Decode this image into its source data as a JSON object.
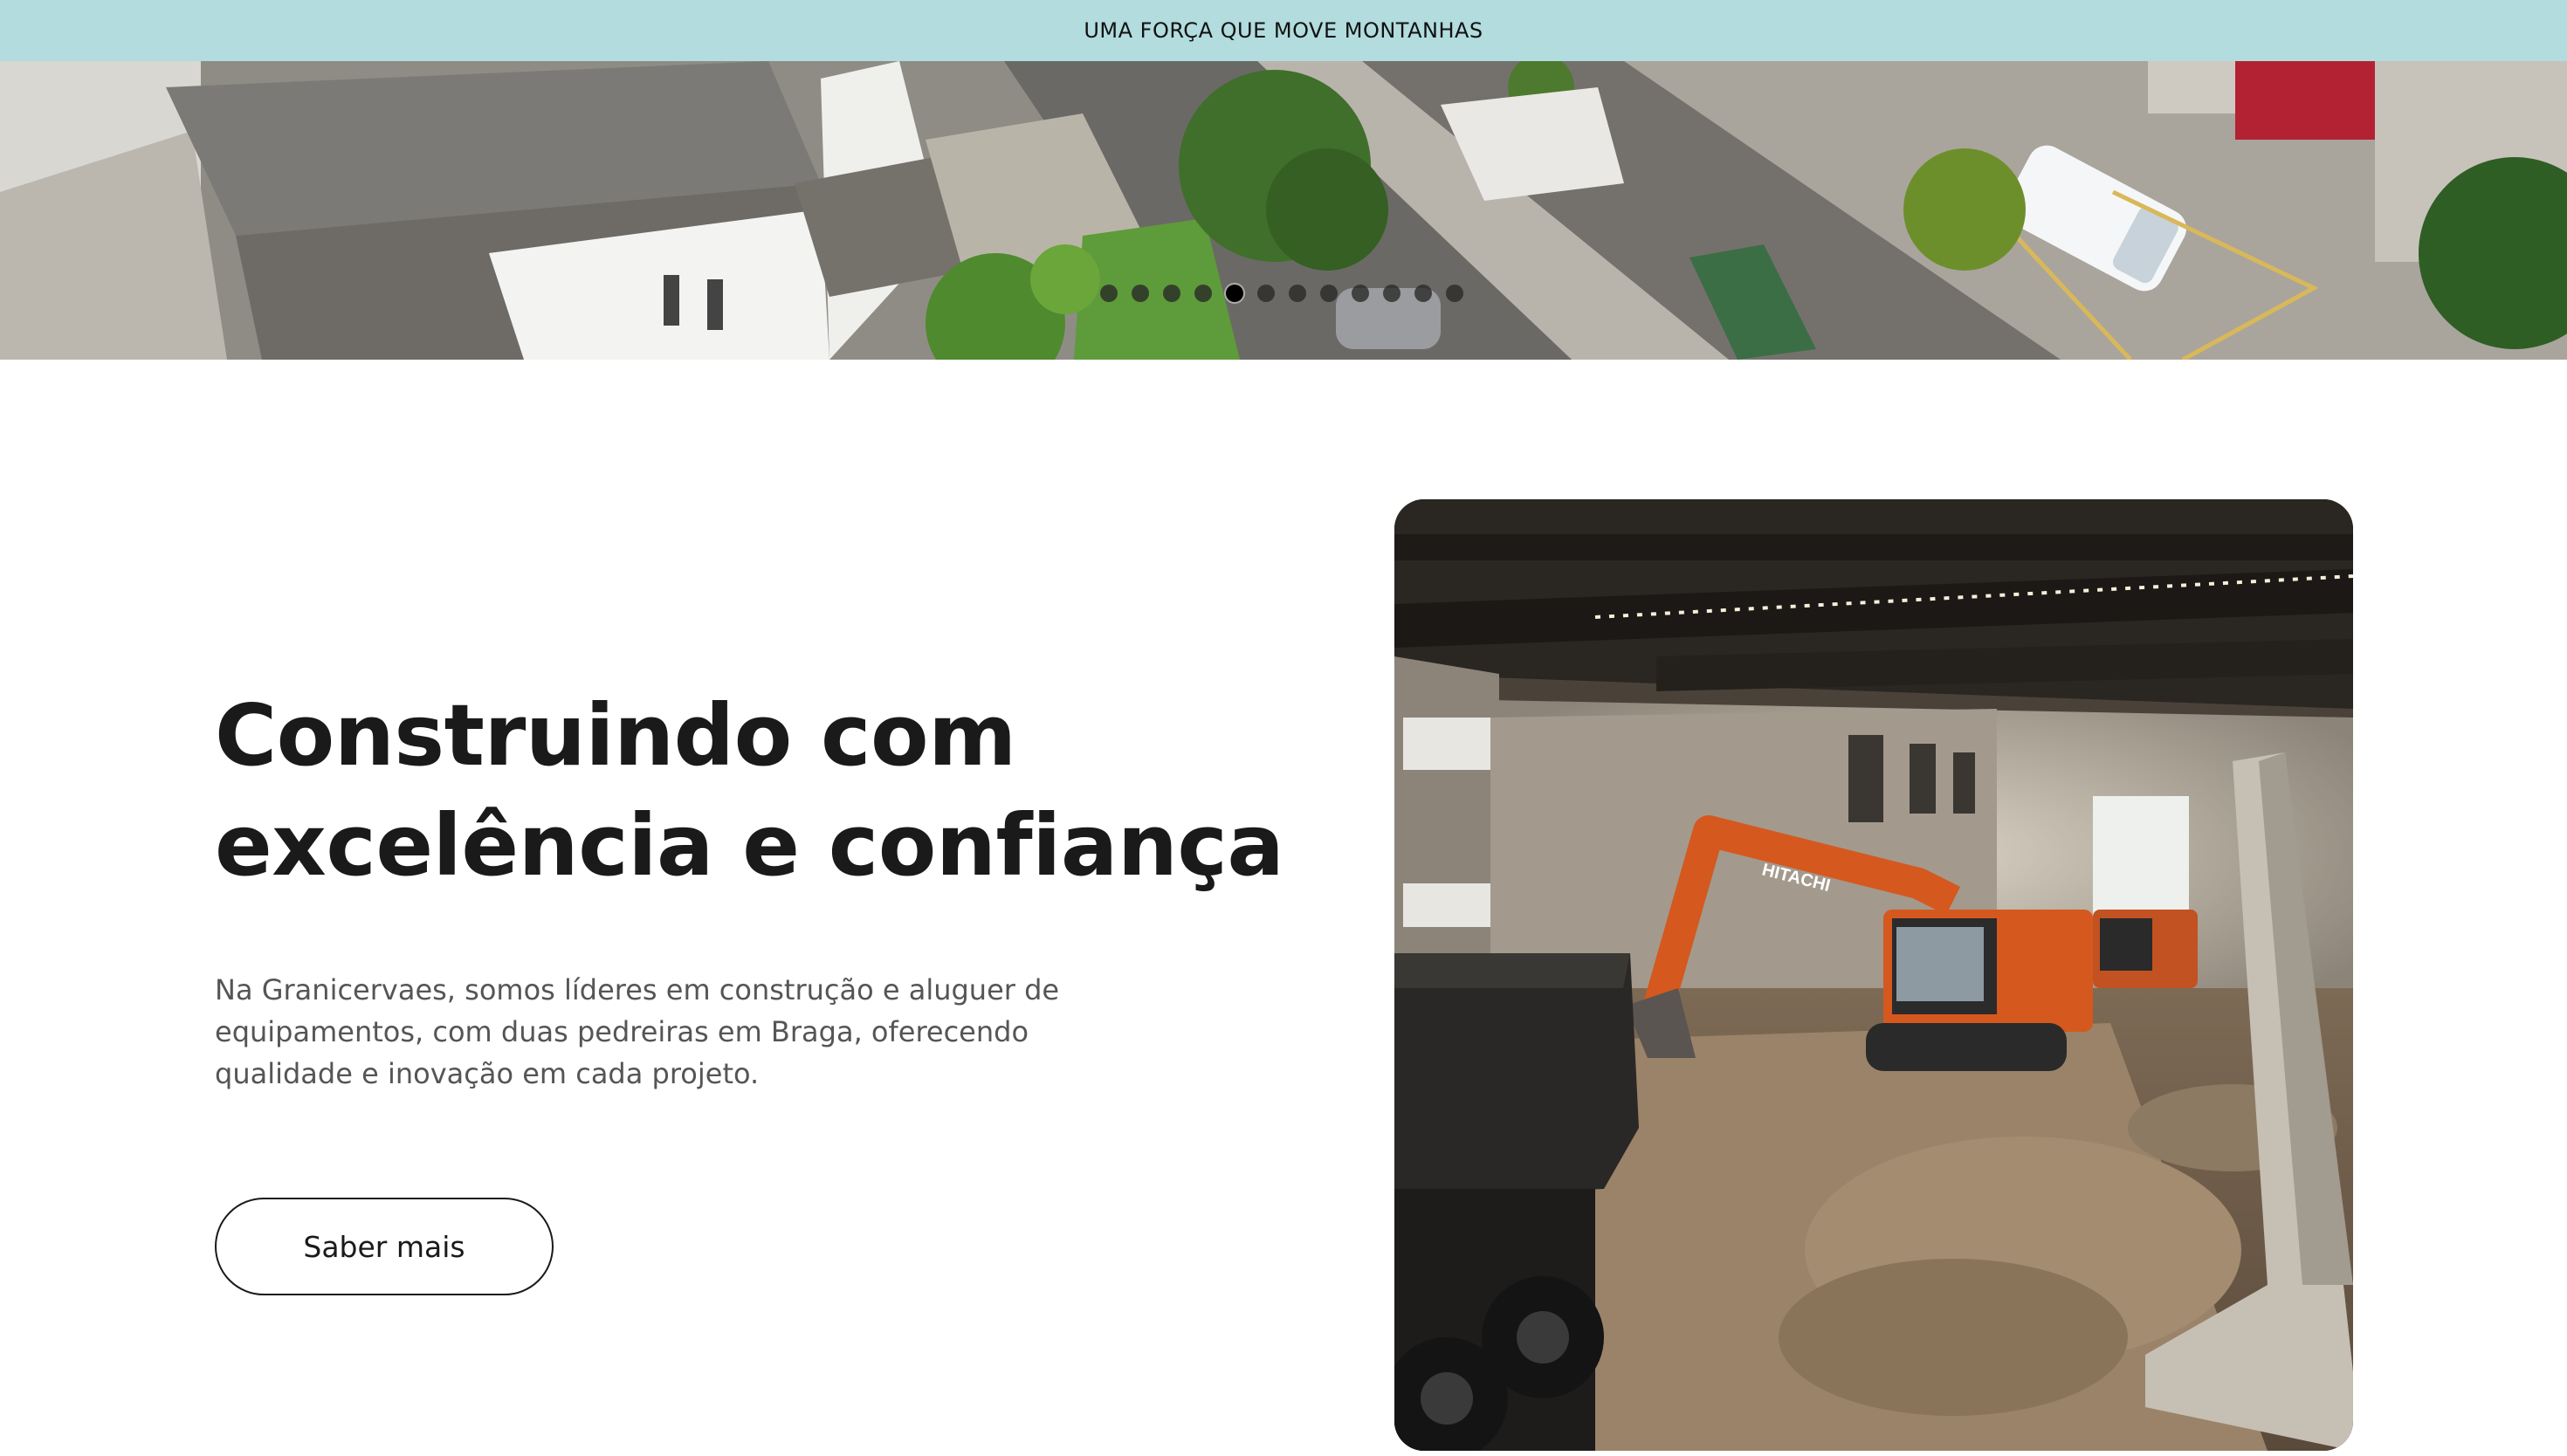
{
  "announcement": {
    "text": "UMA FORÇA QUE MOVE MONTANHAS",
    "background": "#b2dcdd"
  },
  "hero_slider": {
    "image_alt": "aerial-view-of-village-street",
    "dot_count": 12,
    "active_index": 4
  },
  "intro": {
    "headline_line1": "Construindo com",
    "headline_line2": "excelência e confiança",
    "description": "Na Granicervaes, somos líderes em construção e aluguer de equipamentos, com duas pedreiras em Braga, oferecendo qualidade e inovação em cada projeto.",
    "cta_label": "Saber mais"
  },
  "feature_image": {
    "image_alt": "excavator-demolition-inside-building",
    "excavator_brand": "HITACHI",
    "accent": "#d5581f"
  }
}
